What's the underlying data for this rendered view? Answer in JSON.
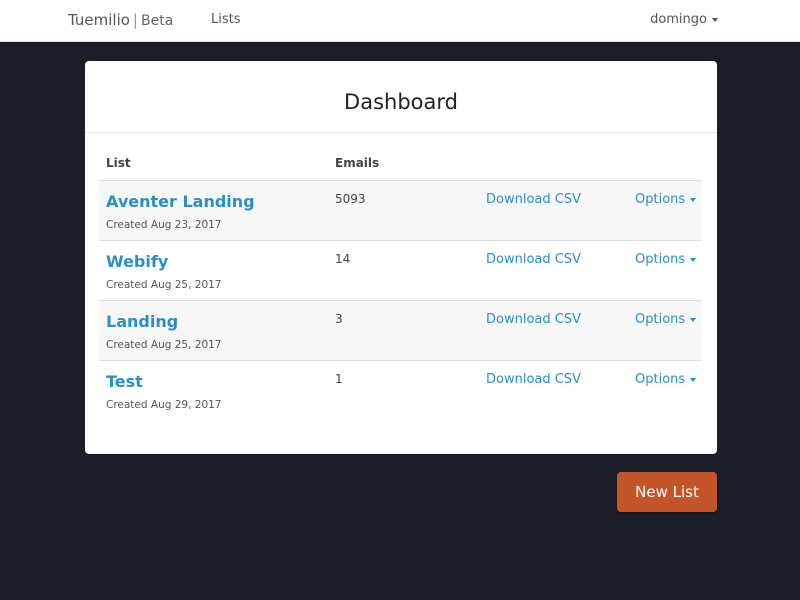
{
  "navbar": {
    "brand": "Tuemilio",
    "brand_separator": "|",
    "brand_tag": "Beta",
    "nav_link": "Lists",
    "user": "domingo"
  },
  "card": {
    "title": "Dashboard",
    "columns": {
      "list": "List",
      "emails": "Emails"
    },
    "rows": [
      {
        "name": "Aventer Landing",
        "created": "Created Aug 23, 2017",
        "emails": "5093",
        "download": "Download CSV",
        "options": "Options"
      },
      {
        "name": "Webify",
        "created": "Created Aug 25, 2017",
        "emails": "14",
        "download": "Download CSV",
        "options": "Options"
      },
      {
        "name": "Landing",
        "created": "Created Aug 25, 2017",
        "emails": "3",
        "download": "Download CSV",
        "options": "Options"
      },
      {
        "name": "Test",
        "created": "Created Aug 29, 2017",
        "emails": "1",
        "download": "Download CSV",
        "options": "Options"
      }
    ]
  },
  "actions": {
    "new_list": "New List"
  },
  "colors": {
    "link": "#2a8fc7",
    "accent": "#c35529",
    "background": "#1b1e28"
  },
  "icons": {
    "dropdown": "caret-down-icon"
  }
}
